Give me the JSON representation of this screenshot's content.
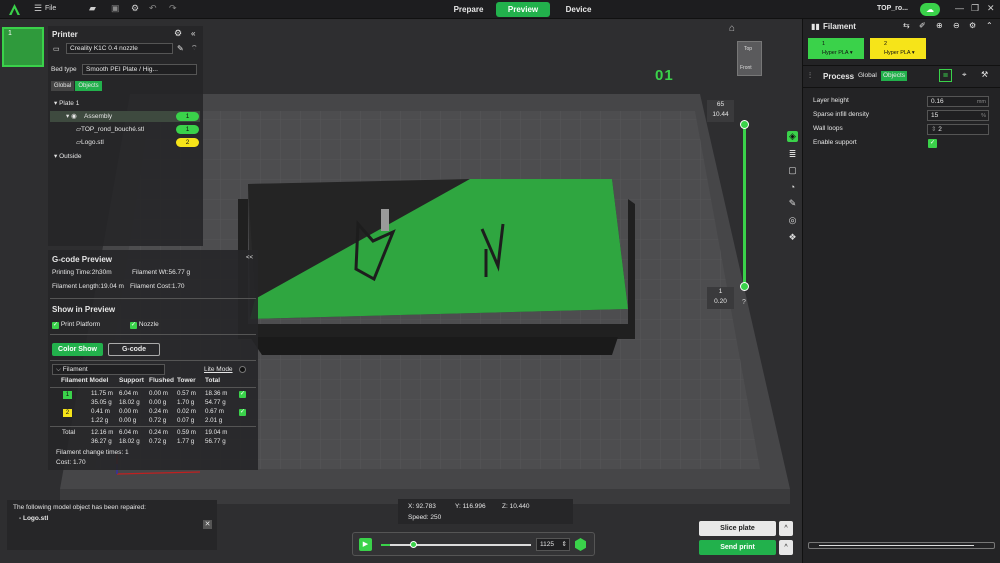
{
  "topbar": {
    "file": "File",
    "tabs": [
      "Prepare",
      "Preview",
      "Device"
    ],
    "project": "TOP_ro...",
    "window_controls": [
      "—",
      "❐",
      "✕"
    ]
  },
  "plate_thumb": {
    "number": "1"
  },
  "printer": {
    "title": "Printer",
    "printer_name": "Creality K1C 0.4 nozzle",
    "bed_label": "Bed type",
    "bed_value": "Smooth PEI Plate / Hig...",
    "global": "Global",
    "objects": "Objects"
  },
  "tree": {
    "plate": "Plate 1",
    "assembly": "Assembly",
    "item1": "TOP_rond_bouché.stl",
    "item2": "Logo.stl",
    "outside": "Outside",
    "badge_assembly": "1",
    "badge_item1": "1",
    "badge_item2": "2"
  },
  "gcode": {
    "title": "G-code Preview",
    "time": "Printing Time:2h30m",
    "weight": "Filament Wt:56.77 g",
    "length": "Filament Length:19.04 m",
    "cost": "Filament Cost:1.70",
    "show_title": "Show in Preview",
    "print_platform": "Print Platform",
    "nozzle": "Nozzle",
    "color_show": "Color Show",
    "gcode_btn": "G-code",
    "filament_select": "Filament",
    "lite_mode": "Lite Mode"
  },
  "fil_table": {
    "headers": [
      "Filament Model",
      "Support",
      "Flushed",
      "Tower",
      "Total"
    ],
    "rows": [
      {
        "id": "1",
        "a": [
          "11.75 m",
          "6.04 m",
          "0.00 m",
          "0.57 m",
          "18.36 m"
        ],
        "b": [
          "35.05 g",
          "18.02 g",
          "0.00 g",
          "1.70 g",
          "54.77 g"
        ]
      },
      {
        "id": "2",
        "a": [
          "0.41 m",
          "0.00 m",
          "0.24 m",
          "0.02 m",
          "0.67 m"
        ],
        "b": [
          "1.22 g",
          "0.00 g",
          "0.72 g",
          "0.07 g",
          "2.01 g"
        ]
      }
    ],
    "total_label": "Total",
    "total_a": [
      "12.16 m",
      "6.04 m",
      "0.24 m",
      "0.59 m",
      "19.04 m"
    ],
    "total_b": [
      "36.27 g",
      "18.02 g",
      "0.72 g",
      "1.77 g",
      "56.77 g"
    ],
    "change_times": "Filament change times:  1",
    "cost": "Cost:  1.70"
  },
  "notification": {
    "title": "The following model object has been repaired:",
    "item": "- Logo.stl"
  },
  "viewport": {
    "plate_label": "01",
    "top": "Top",
    "front": "Front",
    "layer_top_a": "65",
    "layer_top_b": "10.44",
    "layer_bot_a": "1",
    "layer_bot_b": "0.20",
    "question": "?",
    "toggle": "<<"
  },
  "coords": {
    "x": "X: 92.783",
    "y": "Y: 116.996",
    "z": "Z: 10.440",
    "speed": "Speed: 250"
  },
  "playback": {
    "value": "1125",
    "progress": 0.06
  },
  "actions": {
    "slice": "Slice plate",
    "send": "Send print"
  },
  "right": {
    "filament_title": "Filament",
    "f1_id": "1",
    "f1_name": "Hyper PLA ▾",
    "f2_id": "2",
    "f2_name": "Hyper PLA ▾",
    "f1_color": "#3ad24a",
    "f2_color": "#f6e419",
    "process_title": "Process",
    "global": "Global",
    "objects": "Objects",
    "settings": [
      {
        "label": "Layer height",
        "value": "0.16",
        "unit": "mm"
      },
      {
        "label": "Sparse infill density",
        "value": "15",
        "unit": "%"
      },
      {
        "label": "Wall loops",
        "value": "2",
        "unit": ""
      },
      {
        "label": "Enable support",
        "value": "",
        "unit": ""
      }
    ]
  },
  "colors": {
    "accent": "#22b14c",
    "green": "#3ad24a",
    "yellow": "#f6e419"
  }
}
